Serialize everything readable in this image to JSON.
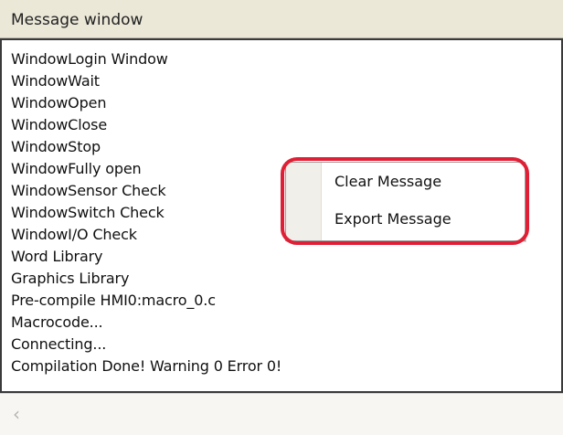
{
  "window": {
    "title": "Message window"
  },
  "messages": [
    "WindowLogin Window",
    "WindowWait",
    "WindowOpen",
    "WindowClose",
    "WindowStop",
    "WindowFully open",
    "WindowSensor Check",
    "WindowSwitch Check",
    "WindowI/O Check",
    "Word Library",
    "Graphics Library",
    "Pre-compile HMI0:macro_0.c",
    "Macrocode...",
    "Connecting...",
    "Compilation Done! Warning 0 Error 0!"
  ],
  "context_menu": {
    "items": [
      "Clear Message",
      "Export Message"
    ]
  },
  "scrollbar": {
    "left_icon": "left-arrow-icon",
    "left_symbol": "‹"
  },
  "colors": {
    "highlight": "#df1f35",
    "panel_border": "#3a3a3a",
    "title_background": "#ebe8d8"
  }
}
